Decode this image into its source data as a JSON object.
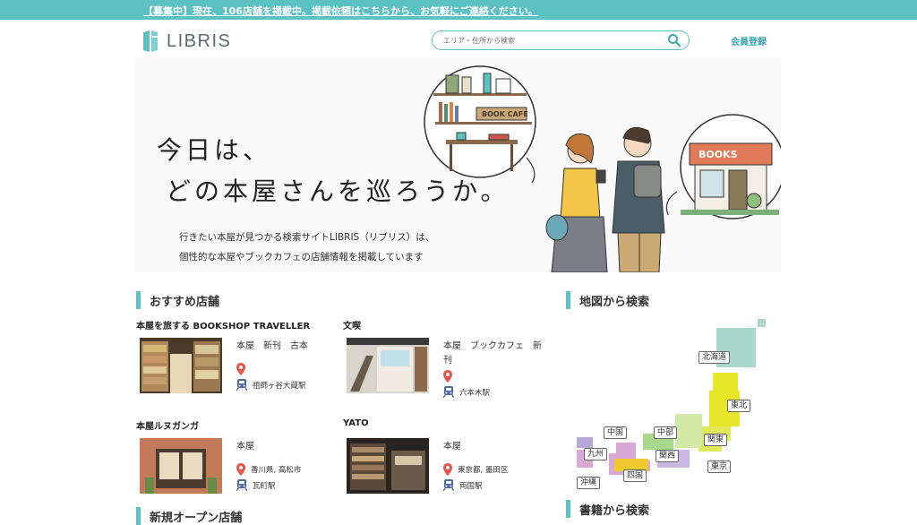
{
  "banner": {
    "text": "【募集中】現在、106店舗を掲載中。掲載依頼はこちらから、お気軽にご連絡ください。"
  },
  "header": {
    "logo_text": "LIBRIS",
    "search_placeholder": "エリア・住所から検索",
    "member_label": "会員登録"
  },
  "hero": {
    "headline_line1": "今日は、",
    "headline_line2": "どの本屋さんを巡ろうか。",
    "desc_line1": "行きたい本屋が見つかる検索サイトLIBRIS（リブリス）は、",
    "desc_line2": "個性的な本屋やブックカフェの店舗情報を掲載しています",
    "sign_bookcafe": "BOOK CAFE",
    "sign_books": "BOOKS"
  },
  "sections": {
    "recommended": "おすすめ店舗",
    "map": "地図から検索",
    "books": "書籍から検索",
    "new_open": "新規オープン店舗"
  },
  "shops": [
    {
      "name": "本屋を旅する BOOKSHOP TRAVELLER",
      "category": "本屋　新刊　古本",
      "address": "",
      "station": "祖師ヶ谷大蔵駅"
    },
    {
      "name": "文喫",
      "category": "本屋　ブックカフェ　新刊",
      "address": "",
      "station": "六本木駅"
    },
    {
      "name": "本屋ルヌガンガ",
      "category": "本屋",
      "address": "香川県, 高松市",
      "station": "瓦町駅"
    },
    {
      "name": "YATO",
      "category": "本屋",
      "address": "東京都, 墨田区",
      "station": "両国駅"
    }
  ],
  "map_regions": [
    "北海道",
    "東北",
    "関東",
    "中部",
    "中国",
    "関西",
    "九州",
    "四国",
    "東京",
    "沖縄"
  ],
  "colors": {
    "accent": "#5cc1c1",
    "member_link": "#3aa8b5",
    "hokkaido": "#a8d8cc",
    "tohoku": "#e8e62a",
    "kanto": "#e1e85a",
    "chubu": "#d4e8a8",
    "chugoku": "#a8d98a",
    "kansai": "#cbb8e0",
    "kyushu": "#d9a8d4",
    "shikoku": "#f0c830",
    "okinawa": "#b8a8d8"
  }
}
